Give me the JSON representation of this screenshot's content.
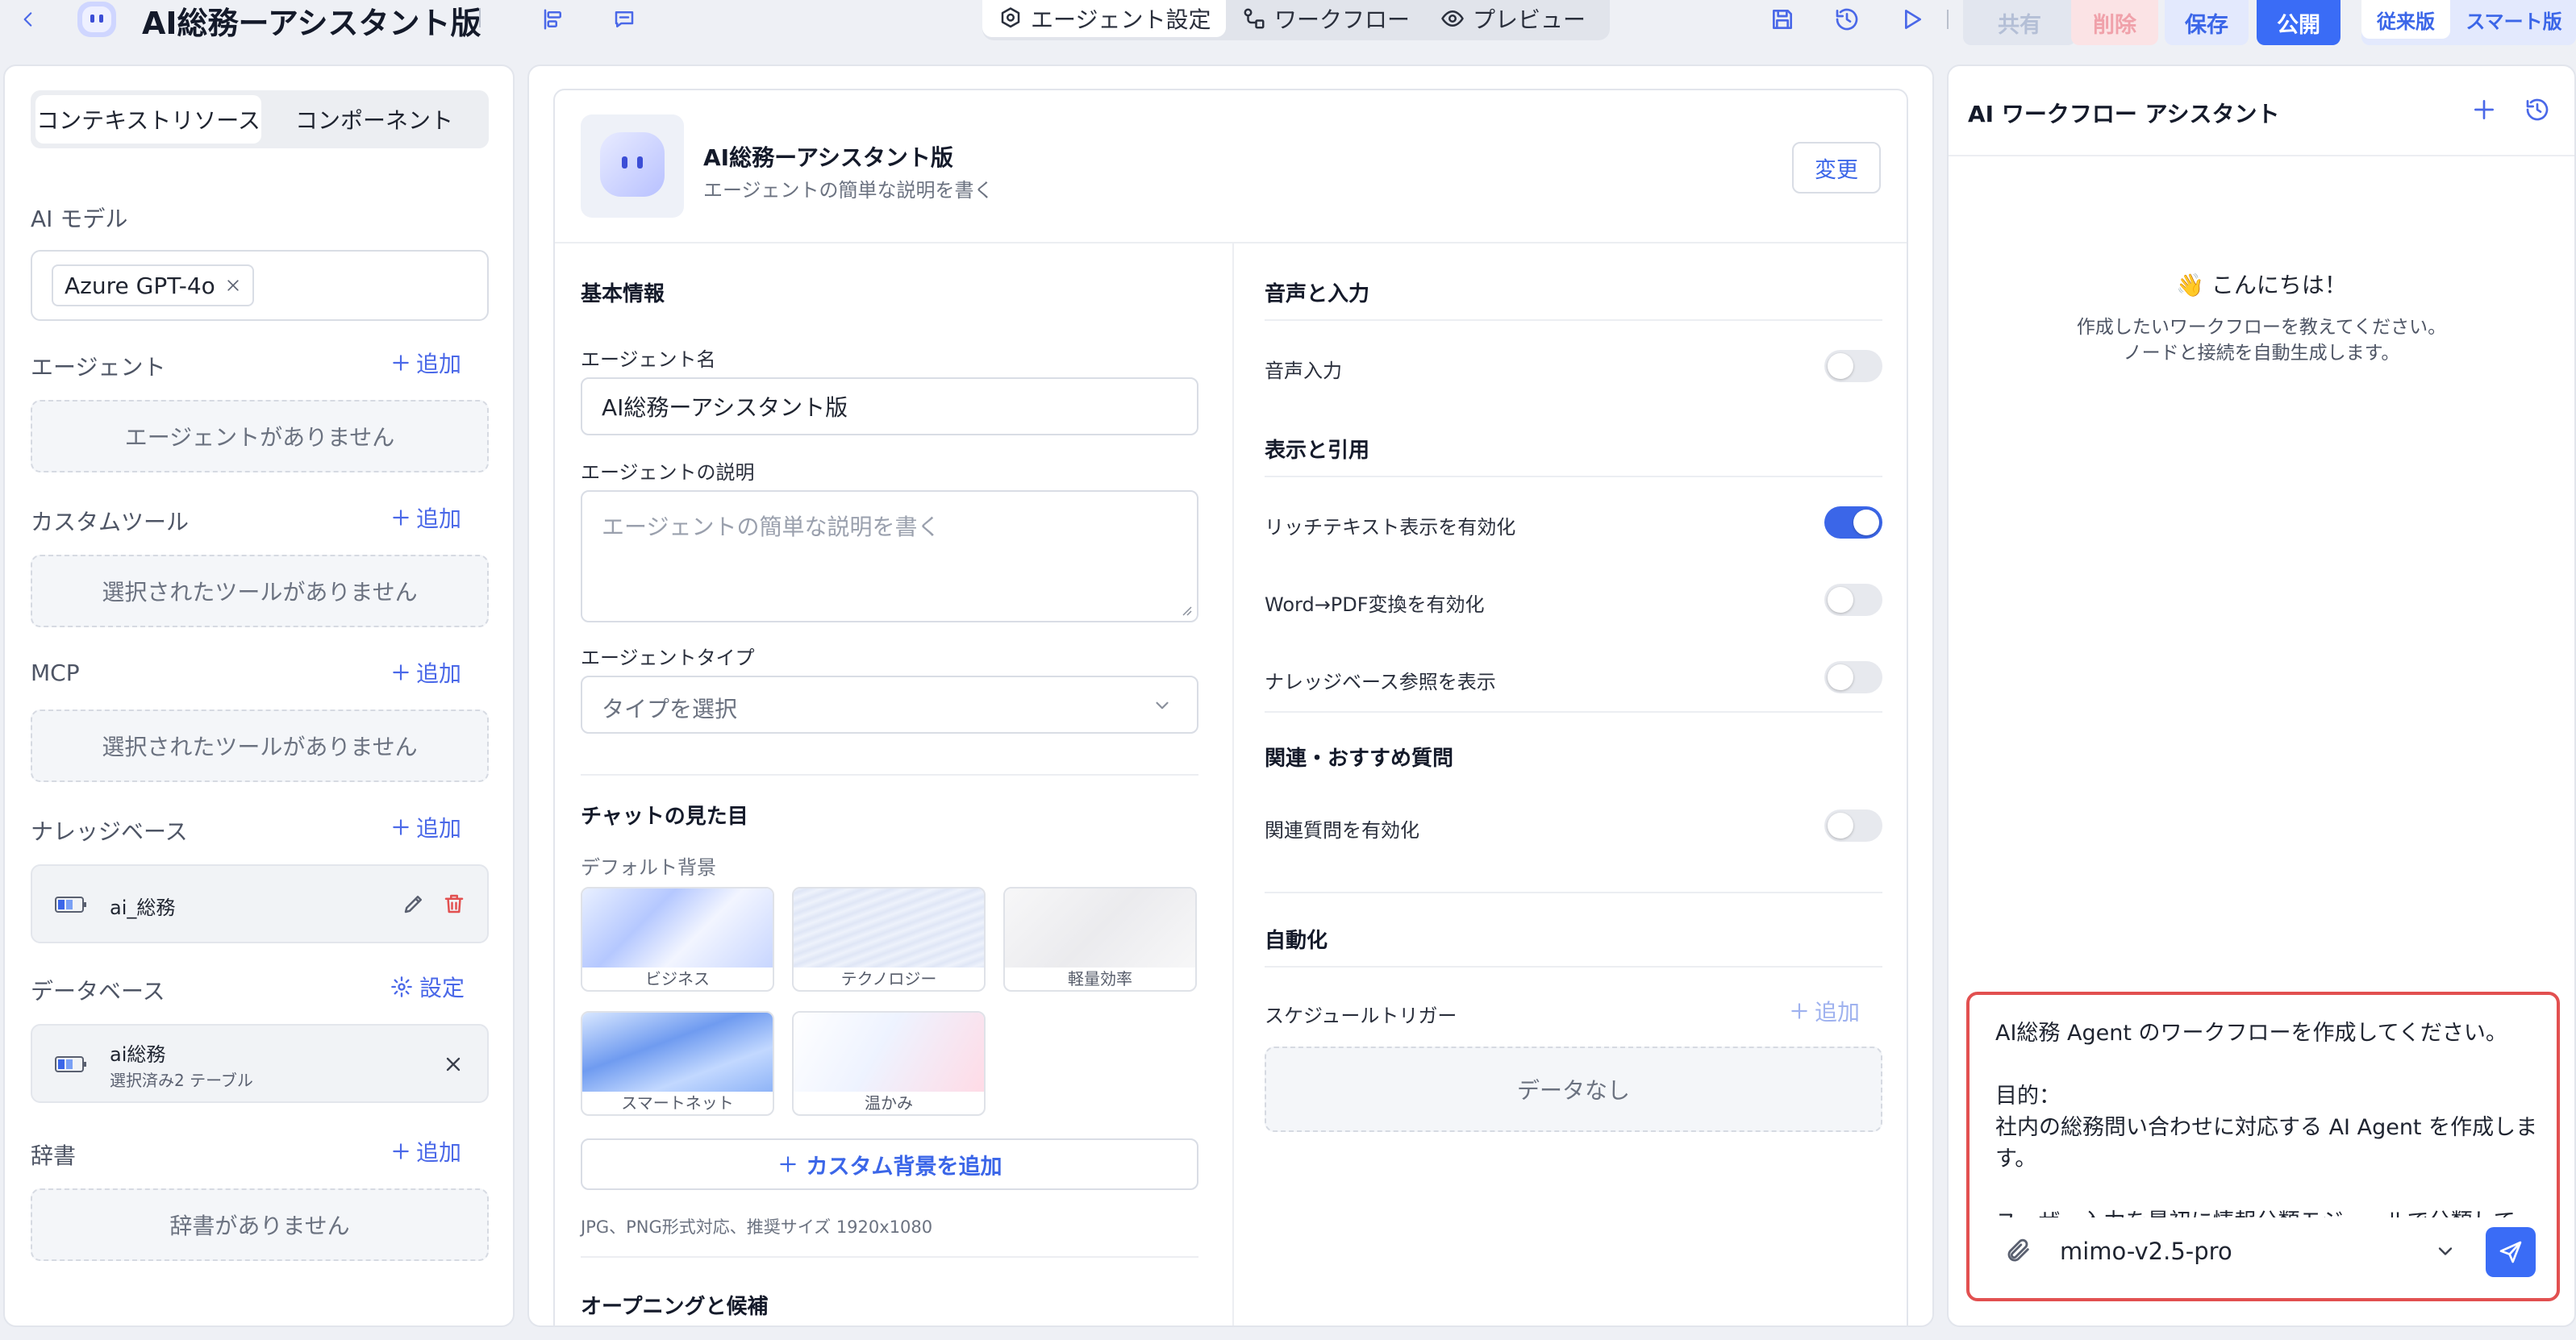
{
  "header": {
    "title": "AI総務ーアシスタント版",
    "modes": [
      "エージェント設定",
      "ワークフロー",
      "プレビュー"
    ],
    "buttons": {
      "share": "共有",
      "delete": "削除",
      "save": "保存",
      "publish": "公開"
    },
    "versions": [
      "従来版",
      "スマート版"
    ]
  },
  "left": {
    "tabs": [
      "コンテキストリソース",
      "コンポーネント"
    ],
    "ai_model": {
      "title": "AI モデル",
      "value": "Azure GPT-4o"
    },
    "add_label": "追加",
    "sections": {
      "agent": {
        "title": "エージェント",
        "empty": "エージェントがありません"
      },
      "custom_tool": {
        "title": "カスタムツール",
        "empty": "選択されたツールがありません"
      },
      "mcp": {
        "title": "MCP",
        "empty": "選択されたツールがありません"
      },
      "knowledge": {
        "title": "ナレッジベース",
        "item": "ai_総務"
      },
      "database": {
        "title": "データベース",
        "action": "設定",
        "item_name": "ai総務",
        "item_sub": "選択済み2 テーブル"
      },
      "dictionary": {
        "title": "辞書",
        "empty": "辞書がありません"
      }
    }
  },
  "center": {
    "agent_name": "AI総務ーアシスタント版",
    "agent_desc": "エージェントの簡単な説明を書く",
    "change_button": "変更",
    "basic": {
      "title": "基本情報",
      "name_label": "エージェント名",
      "name_value": "AI総務ーアシスタント版",
      "desc_label": "エージェントの説明",
      "desc_placeholder": "エージェントの簡単な説明を書く",
      "type_label": "エージェントタイプ",
      "type_placeholder": "タイプを選択"
    },
    "chat_look": {
      "title": "チャットの見た目",
      "bg_label": "デフォルト背景",
      "backgrounds": [
        "ビジネス",
        "テクノロジー",
        "軽量効率",
        "スマートネット",
        "温かみ"
      ],
      "add_bg": "カスタム背景を追加",
      "note": "JPG、PNG形式対応、推奨サイズ 1920x1080",
      "next_title": "オープニングと候補"
    },
    "voice": {
      "title": "音声と入力",
      "voice_input": "音声入力",
      "voice_input_on": false
    },
    "display": {
      "title": "表示と引用",
      "rich_text": "リッチテキスト表示を有効化",
      "rich_text_on": true,
      "word_pdf": "Word→PDF変換を有効化",
      "word_pdf_on": false,
      "kb_ref": "ナレッジベース参照を表示",
      "kb_ref_on": false
    },
    "related": {
      "title": "関連・おすすめ質問",
      "enable": "関連質問を有効化",
      "enable_on": false
    },
    "automation": {
      "title": "自動化",
      "schedule": "スケジュールトリガー",
      "add": "追加",
      "empty": "データなし"
    }
  },
  "right": {
    "title": "AI ワークフロー アシスタント",
    "greeting": "👋 こんにちは！",
    "hint1": "作成したいワークフローを教えてください。",
    "hint2": "ノードと接続を自動生成します。",
    "input_text": "AI総務 Agent のワークフローを作成してください。\n\n目的：\n社内の総務問い合わせに対応する AI Agent を作成します。\n\nユーザー入力を最初に情報分類モジュールで分類して",
    "model": "mimo-v2.5-pro"
  },
  "colors": {
    "accent": "#4a68e8",
    "primary": "#3b66e8",
    "danger": "#e25050",
    "publish_bg": "#3a6cf6"
  }
}
